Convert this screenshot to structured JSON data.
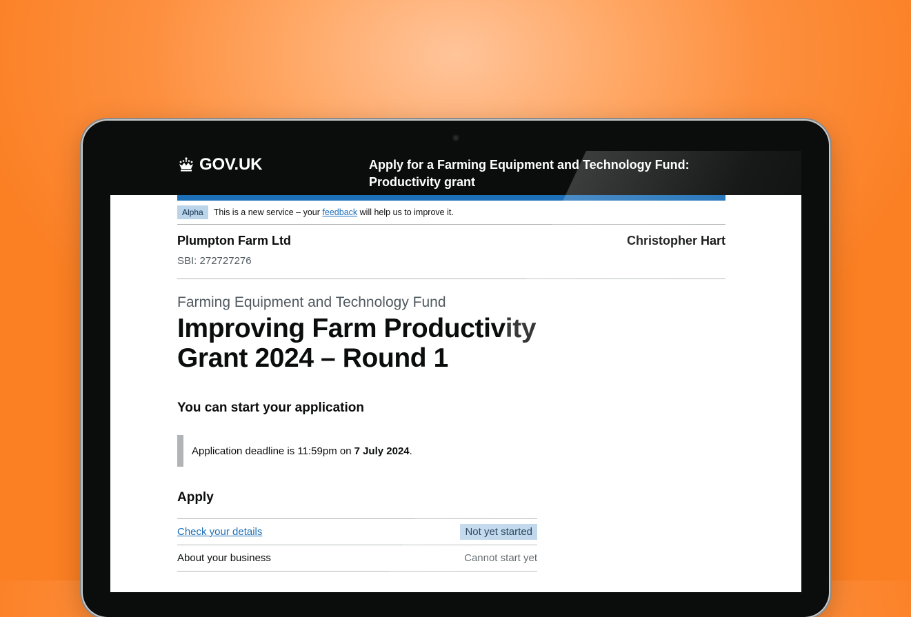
{
  "header": {
    "logo_text": "GOV.UK",
    "service_name": "Apply for a Farming Equipment and Technology Fund: Productivity grant"
  },
  "phase_banner": {
    "tag": "Alpha",
    "text_before": "This is a new service – your",
    "link": "feedback",
    "text_after": "will help us to improve it."
  },
  "business": {
    "name": "Plumpton Farm Ltd",
    "sbi": "SBI: 272727276",
    "user": "Christopher Hart"
  },
  "main": {
    "caption": "Farming Equipment and Technology Fund",
    "title": "Improving Farm Productivity Grant 2024 – Round 1",
    "status_heading": "You can start your application",
    "deadline_text": "Application deadline is 11:59pm on",
    "deadline_date": "7 July 2024",
    "deadline_end": ".",
    "apply_heading": "Apply",
    "tasks": [
      {
        "label": "Check your details",
        "status": "Not yet started"
      },
      {
        "label": "About your business",
        "status": "Cannot start yet"
      }
    ]
  },
  "colors": {
    "background": "#fb7f23",
    "header": "#0b0c0c",
    "brand_blue": "#1d70b8",
    "tag_blue": "#bbd4ea"
  },
  "icons": {
    "logo": "crown-icon"
  }
}
